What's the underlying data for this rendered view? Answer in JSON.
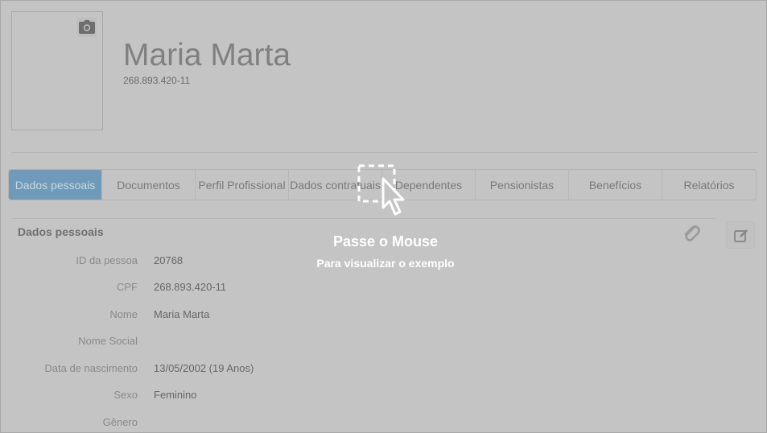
{
  "profile": {
    "name": "Maria Marta",
    "cpf": "268.893.420-11"
  },
  "tabs": [
    {
      "label": "Dados pessoais",
      "active": true
    },
    {
      "label": "Documentos",
      "active": false
    },
    {
      "label": "Perfil Profissional",
      "active": false
    },
    {
      "label": "Dados contratuais",
      "active": false
    },
    {
      "label": "Dependentes",
      "active": false
    },
    {
      "label": "Pensionistas",
      "active": false
    },
    {
      "label": "Benefícios",
      "active": false
    },
    {
      "label": "Relatórios",
      "active": false
    }
  ],
  "section": {
    "title": "Dados pessoais",
    "fields": [
      {
        "label": "ID da pessoa",
        "value": "20768"
      },
      {
        "label": "CPF",
        "value": "268.893.420-11"
      },
      {
        "label": "Nome",
        "value": "Maria Marta"
      },
      {
        "label": "Nome Social",
        "value": ""
      },
      {
        "label": "Data de nascimento",
        "value": "13/05/2002  (19 Anos)"
      },
      {
        "label": "Sexo",
        "value": "Feminino"
      },
      {
        "label": "Gênero",
        "value": ""
      }
    ]
  },
  "overlay": {
    "title": "Passe o Mouse",
    "subtitle": "Para visualizar o exemplo"
  },
  "colors": {
    "background": "#c4c4c4",
    "active_tab": "#6f9ab9"
  },
  "icons": {
    "photo": "camera-icon",
    "attach": "paperclip-icon",
    "edit": "edit-icon",
    "hint": "cursor-select-icon"
  }
}
